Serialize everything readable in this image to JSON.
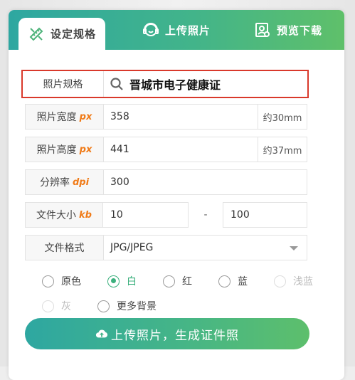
{
  "tabs": [
    {
      "label": "设定规格",
      "icon": "ruler-pencil-icon",
      "active": true
    },
    {
      "label": "上传照片",
      "icon": "face-upload-icon",
      "active": false
    },
    {
      "label": "预览下载",
      "icon": "photo-preview-icon",
      "active": false
    }
  ],
  "spec": {
    "label": "照片规格",
    "value": "晋城市电子健康证"
  },
  "width": {
    "label": "照片宽度",
    "unit": "px",
    "value": "358",
    "suffix": "约30mm"
  },
  "height": {
    "label": "照片高度",
    "unit": "px",
    "value": "441",
    "suffix": "约37mm"
  },
  "dpi": {
    "label": "分辨率",
    "unit": "dpi",
    "value": "300"
  },
  "filesize": {
    "label": "文件大小",
    "unit": "kb",
    "min": "10",
    "sep": "-",
    "max": "100"
  },
  "format": {
    "label": "文件格式",
    "value": "JPG/JPEG"
  },
  "backgrounds": {
    "options": [
      "原色",
      "白",
      "红",
      "蓝",
      "浅蓝",
      "灰",
      "更多背景"
    ],
    "selected": "白"
  },
  "upload_button": "上传照片，生成证件照",
  "colors": {
    "accent": "#3bb07d",
    "highlight_border": "#d9392b",
    "unit_orange": "#f07b18"
  }
}
